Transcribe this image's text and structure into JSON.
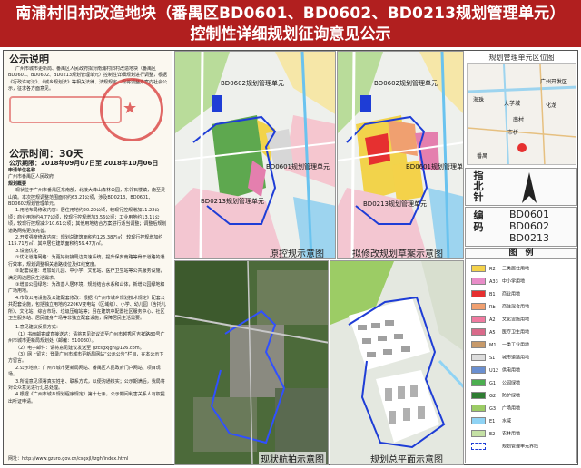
{
  "banner": {
    "title": "南浦村旧村改造地块（番禺区BD0601、BD0602、BD0213规划管理单元）",
    "subtitle": "控制性详细规划征询意见公示"
  },
  "notice": {
    "heading": "公示说明",
    "intro": "广州市城市更新局、番禺区人民政府拟对南浦村旧村改造地块（番禺区BD0601、BD0602、BD0213规划管理单元）控制性详细规划进行调整，根据《行政许可法》、《城乡规划法》等相关法律、法规规定，现将调整方案向社会公示，征求各方面意见。",
    "period_label": "公示时间：",
    "period_value": "30天",
    "dates_label": "公示期限：",
    "dates_value": "2018年09月07日至 2018年10月06日",
    "applicant_label": "申请单位名称",
    "applicant_value": "广州市番禺区人民政府",
    "summary_head": "规划概要",
    "summary_lines": [
      "现状位于广州市番禺区东南部，北接大峰山森林公园，东邻石楼镇，南至灵山镇。本次控规调整范围面积约63.21公顷，涉及BD0213、BD0601、BD0602规划管理单元。",
      "1.用地布局修改内容：居住用地约20.20公顷，较现行控规增加11.22公顷；商业用地约4.77公顷，较现行控规增加3.56公顷；工业用地约13.11公顷，较现行控规减少10.61公顷；其他用地结合方案进行适当调整；调整后规划道路网络更加完善。",
      "2.开发强度修改内容：规划总建筑面积约125.38万㎡，较现行控规增加约115.71万㎡，其中居住建筑面积约59.47万㎡。",
      "3.设施优化",
      "①优化道路网络：为更好衔接周边高速系统，提升保安南路等骨干道路的通行效率，规划调整相关道路线位及红线宽度。",
      "②配套设施：增加幼儿园、中小学、文化站、医疗卫生站等公共服务设施，满足周边居民生活需求。",
      "③增加公园绿地：为改善人居环境，规划结合水系和山体，新增公园绿地和广场用地。",
      "4.市政公用设施及公建配套修改：根据《广州市城乡规划技术规定》配套公共配套设施，包括独立用地的220KV变电站（区域级）、小学、幼儿园（含托儿所）、文化站、综合市场、垃圾压缩站等；另在建筑中配置社区服务中心、社区卫生服务站、居民健身广场等非独立配套设施，保障居民生活需要。"
    ],
    "contact_lines": [
      "1.意见建议反馈方式：",
      "（1）书面邮寄或直接送达：请将意见建议送至广州市越秀区吉祥路80号广州市城市更新局规划处（邮编：510030）。",
      "（2）电子邮件：请将意见建议发送至 gzcsgxjgh@126.com。",
      "（3）网上留言：登录广州市城市更新局网站“公示公告”栏目，在本公示下方留言。",
      "2.公示地点：广州市城市更新局网站、番禺区人民政府门户网站、项目现场。",
      "3.所提意见须署真实姓名、联系方式，以便沟通核实；公示期满后，我局将对公众意见进行汇总处理。",
      "4.根据《广州市城乡规划程序规定》第十七条，公示期间利害关系人有权提出听证申请。"
    ],
    "footer": "网址：http://www.gzuro.gov.cn/csgxjl/fzgh/index.html",
    "seal_text": "广州市城市更新局"
  },
  "panels": {
    "original_caption": "原控规示意图",
    "draft_caption": "拟修改规划草案示意图",
    "aerial_caption": "现状航拍示意图",
    "master_caption": "规划总平面示意图",
    "unit_bd0602": "BD0602规划管理单元",
    "unit_bd0601": "BD0601规划管理单元",
    "unit_bd0213": "BD0213规划管理单元"
  },
  "right": {
    "locmap_title": "规划管理单元区位图",
    "loc_labels": [
      "广州开发区",
      "大学城",
      "海珠",
      "化龙",
      "南村",
      "市桥",
      "番禺"
    ],
    "north_label": "指北针",
    "code_label": "编码",
    "codes": [
      "BD0601",
      "BD0602",
      "BD0213"
    ],
    "legend_label": "图　例",
    "legend": [
      {
        "code": "R2",
        "name": "二类居住用地",
        "color": "#f4d24a"
      },
      {
        "code": "A33",
        "name": "中小学用地",
        "color": "#e88dc8"
      },
      {
        "code": "B1",
        "name": "商业用地",
        "color": "#e63030"
      },
      {
        "code": "Rb",
        "name": "商住混合用地",
        "color": "#f0a070"
      },
      {
        "code": "A2",
        "name": "文化设施用地",
        "color": "#f07aa0"
      },
      {
        "code": "A5",
        "name": "医疗卫生用地",
        "color": "#d96a8a"
      },
      {
        "code": "M1",
        "name": "一类工业用地",
        "color": "#c79a6a"
      },
      {
        "code": "S1",
        "name": "城市道路用地",
        "color": "#dddddd"
      },
      {
        "code": "U12",
        "name": "供电用地",
        "color": "#6a8fd0"
      },
      {
        "code": "G1",
        "name": "公园绿地",
        "color": "#4caf50"
      },
      {
        "code": "G2",
        "name": "防护绿地",
        "color": "#2e7d32"
      },
      {
        "code": "G3",
        "name": "广场用地",
        "color": "#9ccc65"
      },
      {
        "code": "E1",
        "name": "水域",
        "color": "#8fd3f4"
      },
      {
        "code": "E2",
        "name": "农林用地",
        "color": "#c5e1a5"
      },
      {
        "code": "",
        "name": "规划管理单元界线",
        "color": "#ffffff"
      }
    ]
  }
}
